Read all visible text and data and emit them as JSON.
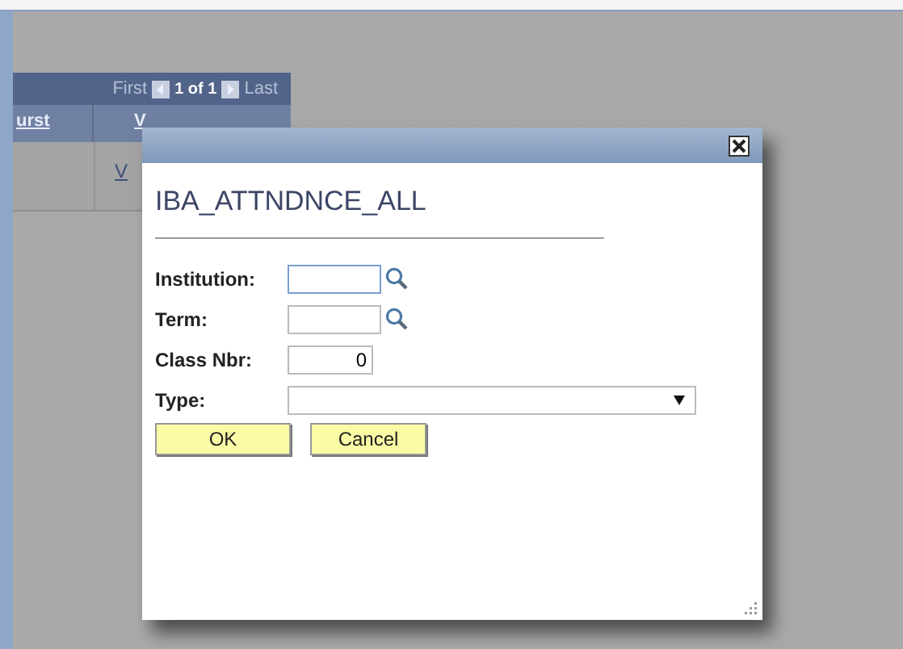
{
  "grid": {
    "navigation": {
      "first": "First",
      "position": "1 of 1",
      "last": "Last"
    },
    "columns": [
      "urst",
      "V"
    ],
    "rows": [
      {
        "column_2": "V"
      }
    ]
  },
  "dialog": {
    "title": "IBA_ATTNDNCE_ALL",
    "fields": [
      {
        "kind": "lookup",
        "label": "Institution:",
        "focused": true
      },
      {
        "kind": "lookup",
        "label": "Term:",
        "focused": false
      },
      {
        "kind": "number",
        "label": "Class Nbr:",
        "value": "0",
        "focused": false
      },
      {
        "kind": "select",
        "label": "Type:",
        "focused": false
      }
    ],
    "buttons": [
      "OK",
      "Cancel"
    ]
  }
}
